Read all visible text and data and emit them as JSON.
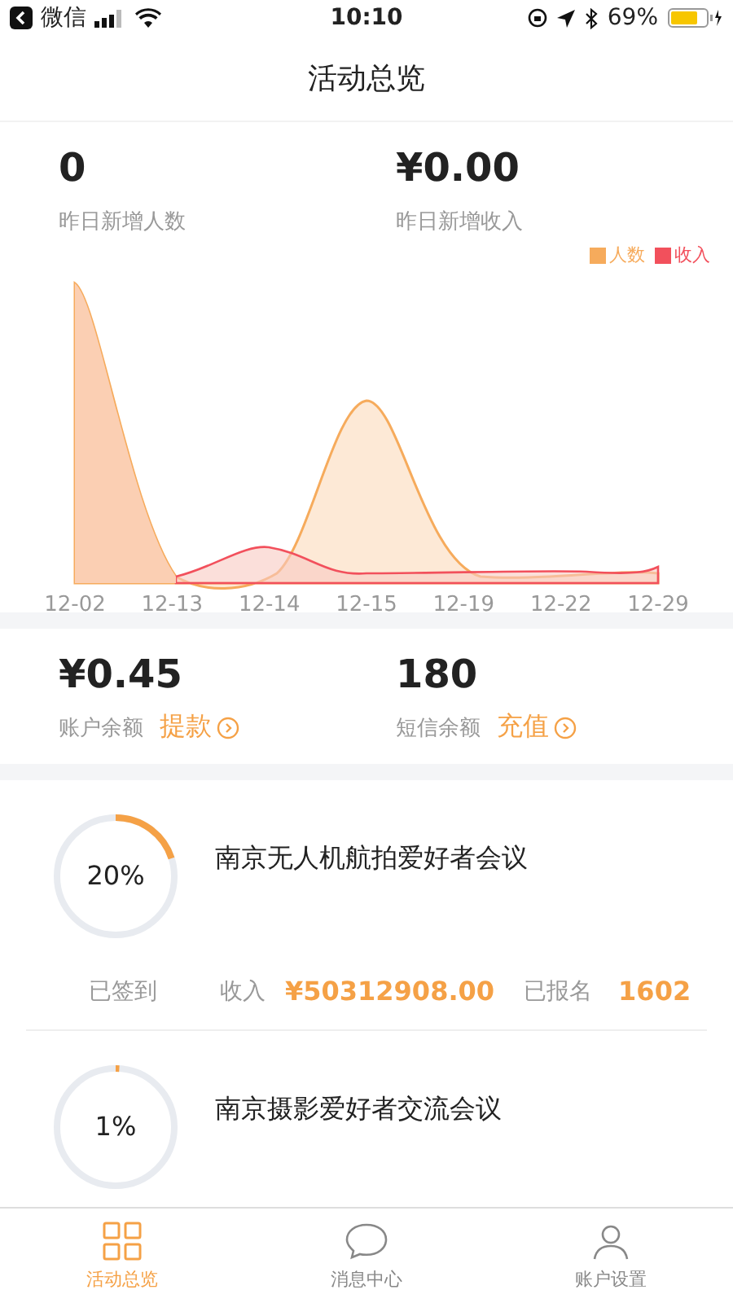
{
  "status_bar": {
    "back_app": "微信",
    "time": "10:10",
    "battery": "69%"
  },
  "header": {
    "title": "活动总览"
  },
  "yesterday": [
    {
      "value": "0",
      "label": "昨日新增人数"
    },
    {
      "value": "¥0.00",
      "label": "昨日新增收入"
    }
  ],
  "chart": {
    "legend": [
      {
        "label": "人数",
        "color": "#f6ab5c"
      },
      {
        "label": "收入",
        "color": "#f2505c"
      }
    ],
    "x_labels": [
      "12-02",
      "12-13",
      "12-14",
      "12-15",
      "12-19",
      "12-22",
      "12-29"
    ]
  },
  "balances": [
    {
      "value": "¥0.45",
      "label": "账户余额",
      "action": "提款"
    },
    {
      "value": "180",
      "label": "短信余额",
      "action": "充值"
    }
  ],
  "events": [
    {
      "title": "南京无人机航拍爱好者会议",
      "percent": "20%",
      "checked_in_label": "已签到",
      "income_label": "收入",
      "income": "¥50312908.00",
      "signed_up_label": "已报名",
      "signed_up": "1602"
    },
    {
      "title": "南京摄影爱好者交流会议",
      "percent": "1%"
    }
  ],
  "tabs": [
    {
      "label": "活动总览",
      "selected": true
    },
    {
      "label": "消息中心",
      "selected": false
    },
    {
      "label": "账户设置",
      "selected": false
    }
  ]
}
